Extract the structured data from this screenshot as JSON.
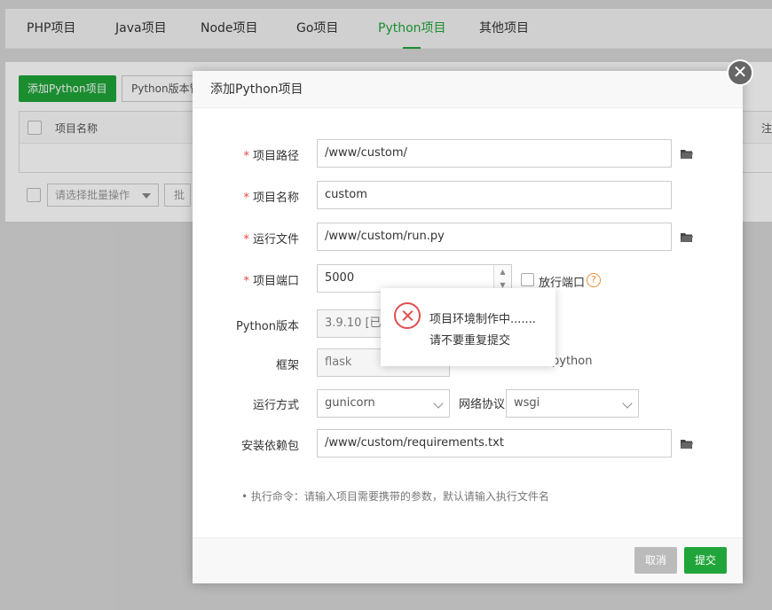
{
  "tabs": [
    {
      "label": "PHP项目",
      "active": false
    },
    {
      "label": "Java项目",
      "active": false
    },
    {
      "label": "Node项目",
      "active": false
    },
    {
      "label": "Go项目",
      "active": false
    },
    {
      "label": "Python项目",
      "active": true
    },
    {
      "label": "其他项目",
      "active": false
    }
  ],
  "background": {
    "add_button": "添加Python项目",
    "version_button": "Python版本管",
    "col_name": "项目名称",
    "col_note": "注",
    "batch_placeholder": "请选择批量操作",
    "batch_button": "批"
  },
  "dialog": {
    "title": "添加Python项目",
    "fields": {
      "path_label": "项目路径",
      "path_value": "/www/custom/",
      "name_label": "项目名称",
      "name_value": "custom",
      "run_file_label": "运行文件",
      "run_file_value": "/www/custom/run.py",
      "port_label": "项目端口",
      "port_value": "5000",
      "open_port_label": "放行端口",
      "python_version_label": "Python版本",
      "python_version_value": "3.9.10 [已安",
      "framework_label": "框架",
      "framework_value": "flask",
      "framework_extra": "python",
      "run_mode_label": "运行方式",
      "run_mode_value": "gunicorn",
      "protocol_label": "网络协议",
      "protocol_value": "wsgi",
      "requirements_label": "安装依赖包",
      "requirements_value": "/www/custom/requirements.txt"
    },
    "tip": "执行命令：请输入项目需要携带的参数，默认请输入执行文件名",
    "cancel_label": "取消",
    "submit_label": "提交"
  },
  "toast": {
    "line1": "项目环境制作中.......",
    "line2": "请不要重复提交"
  },
  "colors": {
    "accent": "#20a53a",
    "required": "#e44444",
    "error": "#e14e4e",
    "help": "#e69137"
  }
}
